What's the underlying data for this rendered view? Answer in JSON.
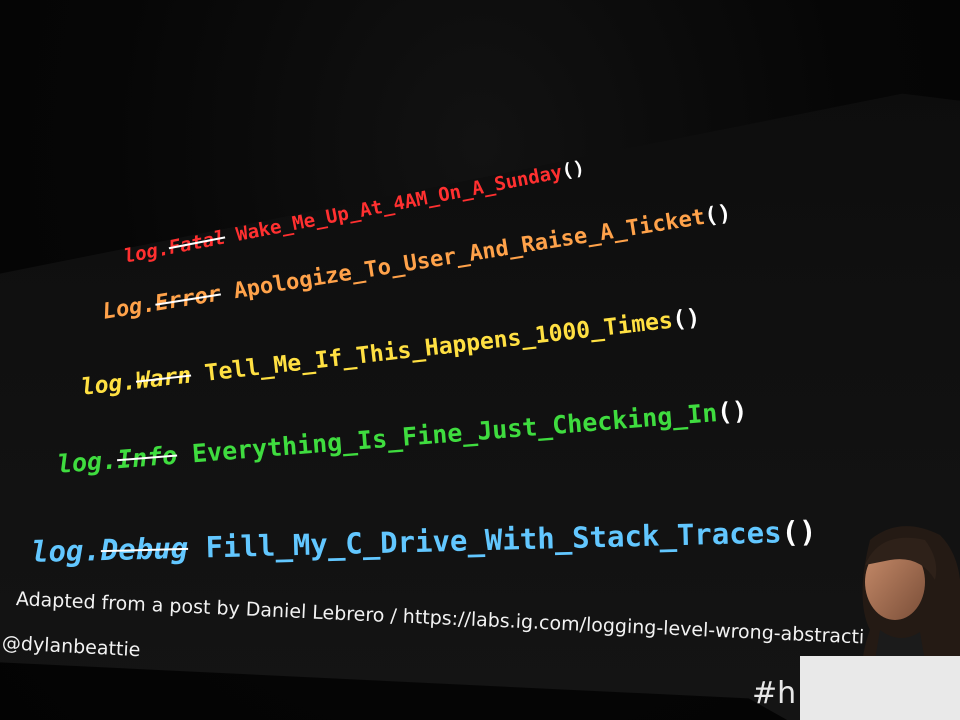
{
  "slide": {
    "lines": [
      {
        "prefix": "log.",
        "struck": "Fatal",
        "text": "Wake_Me_Up_At_4AM_On_A_Sunday",
        "parens": "()",
        "color": "#ff3030"
      },
      {
        "prefix": "Log.",
        "struck": "Error",
        "text": "Apologize_To_User_And_Raise_A_Ticket",
        "parens": "()",
        "color": "#ffa24a"
      },
      {
        "prefix": "log.",
        "struck": "Warn",
        "text": "Tell_Me_If_This_Happens_1000_Times",
        "parens": "()",
        "color": "#ffe042"
      },
      {
        "prefix": "log.",
        "struck": "Info",
        "text": "Everything_Is_Fine_Just_Checking_In",
        "parens": "()",
        "color": "#3fdc3f"
      },
      {
        "prefix": "log.",
        "struck": "Debug",
        "text": "Fill_My_C_Drive_With_Stack_Traces",
        "parens": "()",
        "color": "#62c7ff"
      }
    ],
    "credit": "Adapted from a post by Daniel Lebrero / https://labs.ig.com/logging-level-wrong-abstracti",
    "handle": "@dylanbeattie",
    "hashtag": "#h"
  }
}
